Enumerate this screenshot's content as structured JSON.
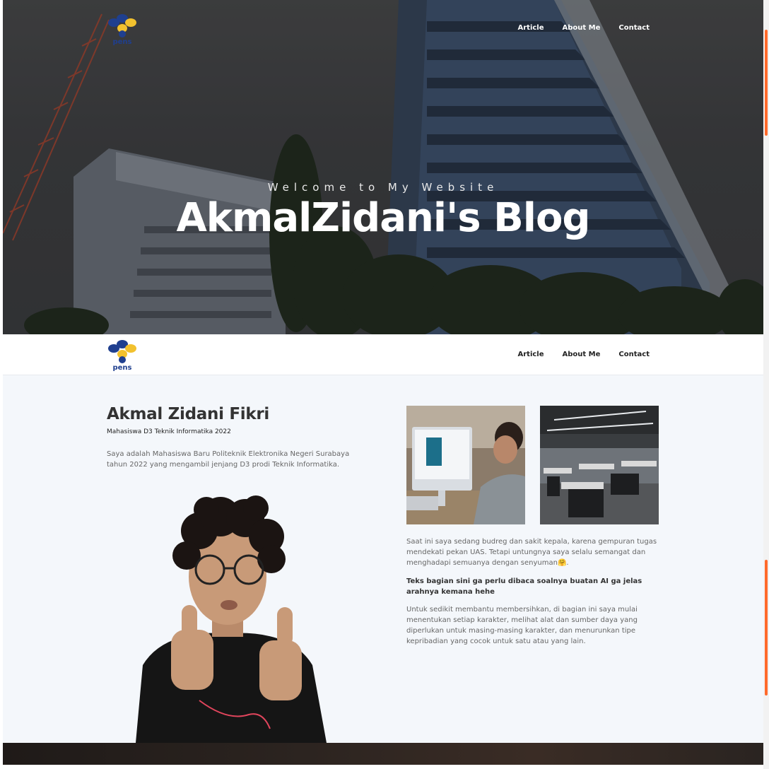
{
  "colors": {
    "accent": "#ff6a2c",
    "logo_blue": "#1f3f8f",
    "logo_yellow": "#f2c12e"
  },
  "logo": {
    "text": "pens"
  },
  "nav": [
    {
      "label": "Article"
    },
    {
      "label": "About Me"
    },
    {
      "label": "Contact"
    }
  ],
  "hero": {
    "subtitle": "Welcome to My Website",
    "title": "AkmalZidani's Blog"
  },
  "about": {
    "name": "Akmal Zidani Fikri",
    "role": "Mahasiswa D3 Teknik Informatika 2022",
    "bio": "Saya adalah Mahasiswa Baru Politeknik Elektronika Negeri Surabaya tahun 2022 yang mengambil jenjang D3 prodi Teknik Informatika.",
    "paragraph1": "Saat ini saya sedang budreg dan sakit kepala, karena gempuran tugas mendekati pekan UAS. Tetapi untungnya saya selalu semangat dan menghadapi semuanya dengan senyuman🤗.",
    "paragraph2": "Teks bagian sini ga perlu dibaca soalnya buatan AI ga jelas arahnya kemana hehe",
    "paragraph3": "Untuk sedikit membantu membersihkan, di bagian ini saya mulai menentukan setiap karakter, melihat alat dan sumber daya yang diperlukan untuk masing-masing karakter, dan menurunkan tipe kepribadian yang cocok untuk satu atau yang lain."
  }
}
